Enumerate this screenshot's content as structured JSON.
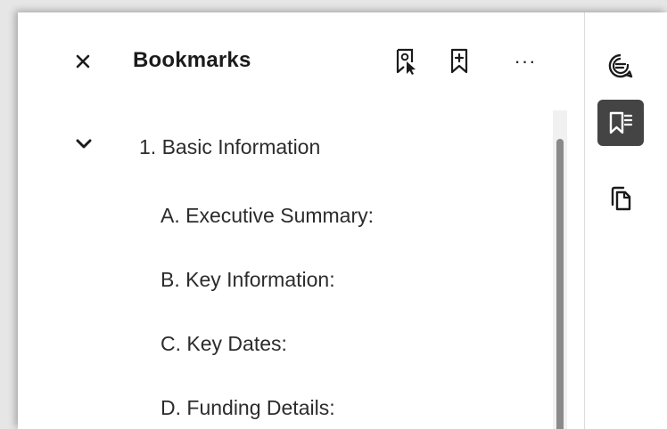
{
  "panel": {
    "title": "Bookmarks",
    "close_icon": "close-icon",
    "toolbar_icons": [
      "bookmark-select-icon",
      "add-bookmark-icon",
      "more-options-icon"
    ],
    "more_label": "···"
  },
  "tree": {
    "expanded": true,
    "top": "1. Basic Information",
    "children": [
      "A. Executive Summary:",
      "B. Key Information:",
      "C. Key Dates:",
      "D. Funding Details:"
    ]
  },
  "rail": {
    "items": [
      {
        "icon": "comments-icon",
        "active": false
      },
      {
        "icon": "bookmarks-icon",
        "active": true
      },
      {
        "icon": "copy-pages-icon",
        "active": false
      }
    ]
  },
  "colors": {
    "active_bg": "#444444",
    "text": "#2c2c2c"
  }
}
